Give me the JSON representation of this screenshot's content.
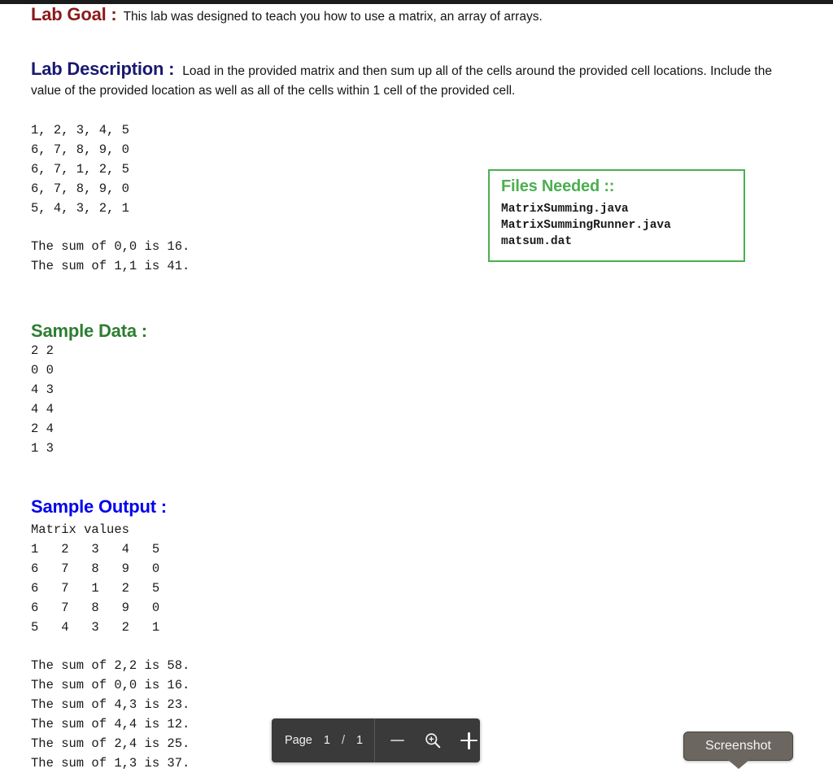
{
  "document": {
    "lab_goal": {
      "heading": "Lab Goal :",
      "text": "This lab was designed to teach you how to use a matrix, an array of arrays."
    },
    "lab_description": {
      "heading": "Lab Description :",
      "text": "Load in the provided matrix and then sum up all of the cells around the provided cell locations.  Include the value of the provided location as well as all of the cells within 1 cell of the provided cell."
    },
    "matrix_input": "1, 2, 3, 4, 5\n6, 7, 8, 9, 0\n6, 7, 1, 2, 5\n6, 7, 8, 9, 0\n5, 4, 3, 2, 1",
    "intro_sums": "The sum of 0,0 is 16.\nThe sum of 1,1 is 41.",
    "files_needed": {
      "heading": "Files Needed ::",
      "files": "MatrixSumming.java\nMatrixSummingRunner.java\nmatsum.dat"
    },
    "sample_data": {
      "heading": "Sample Data :",
      "text": "2 2\n0 0\n4 3\n4 4\n2 4\n1 3"
    },
    "sample_output": {
      "heading": "Sample Output :",
      "matrix_label": "Matrix values",
      "matrix": "1   2   3   4   5\n6   7   8   9   0\n6   7   1   2   5\n6   7   8   9   0\n5   4   3   2   1",
      "sums": "The sum of 2,2 is 58.\nThe sum of 0,0 is 16.\nThe sum of 4,3 is 23.\nThe sum of 4,4 is 12.\nThe sum of 2,4 is 25.\nThe sum of 1,3 is 37."
    }
  },
  "toolbar": {
    "page_label": "Page",
    "current_page": "1",
    "separator": "/",
    "total_pages": "1",
    "zoom_out_icon": "minus-icon",
    "zoom_icon": "magnifier-plus-icon",
    "zoom_in_icon": "plus-icon"
  },
  "tooltip": {
    "screenshot_label": "Screenshot"
  },
  "colors": {
    "goal_heading": "#8B1A1A",
    "description_heading": "#191970",
    "sample_data_heading": "#2E7D32",
    "sample_output_heading": "#0000EE",
    "files_box_border": "#4CAF50",
    "toolbar_bg": "#3a3a3a",
    "tooltip_bg": "#6b6660"
  }
}
